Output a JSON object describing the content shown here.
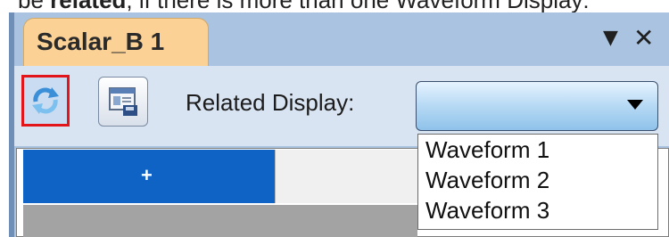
{
  "document": {
    "line_prefix": "be ",
    "line_bold": "related",
    "line_suffix": "; if there is more than one Waveform Display:"
  },
  "tab": {
    "title": "Scalar_B 1"
  },
  "window_controls": {
    "menu_icon": "▼",
    "close_icon": "✕"
  },
  "toolbar": {
    "refresh_icon": "refresh-icon",
    "save_icon": "save-display-icon",
    "related_label": "Related Display:",
    "combo_value": ""
  },
  "content": {
    "plus": "+"
  },
  "dropdown": {
    "options": [
      "Waveform 1",
      "Waveform 2",
      "Waveform 3"
    ]
  },
  "colors": {
    "tab_bg": "#fbd196",
    "highlight_border": "#e2151a",
    "selected_row": "#0f63c4"
  }
}
